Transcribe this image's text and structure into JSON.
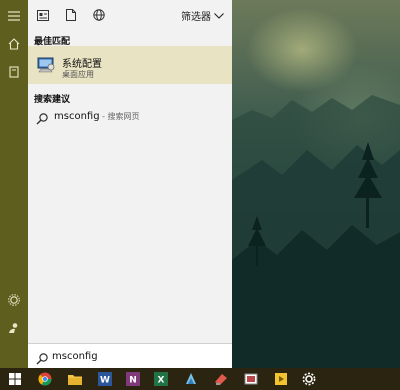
{
  "topbar": {
    "filter_label": "筛选器"
  },
  "sections": {
    "best_match": "最佳匹配",
    "search_suggestions": "搜索建议"
  },
  "best_match_item": {
    "title": "系统配置",
    "subtitle": "桌面应用"
  },
  "suggestion_item": {
    "query": "msconfig",
    "suffix": " - 搜索网页"
  },
  "search": {
    "value": "msconfig"
  },
  "colors": {
    "rail": "#5e5e1f",
    "highlight": "#e8e3c3",
    "panel": "#f2f2f2",
    "taskbar": "#2b2410"
  },
  "rail_icons": [
    "hamburger-icon",
    "home-icon",
    "notebook-icon",
    "settings-icon",
    "feedback-icon"
  ],
  "taskbar_icons": [
    "windows-start-icon",
    "chrome-icon",
    "file-explorer-icon",
    "word-icon",
    "onenote-icon",
    "excel-icon",
    "app-icon",
    "app-icon-2",
    "app-icon-3",
    "app-icon-4",
    "settings-gear-icon"
  ]
}
